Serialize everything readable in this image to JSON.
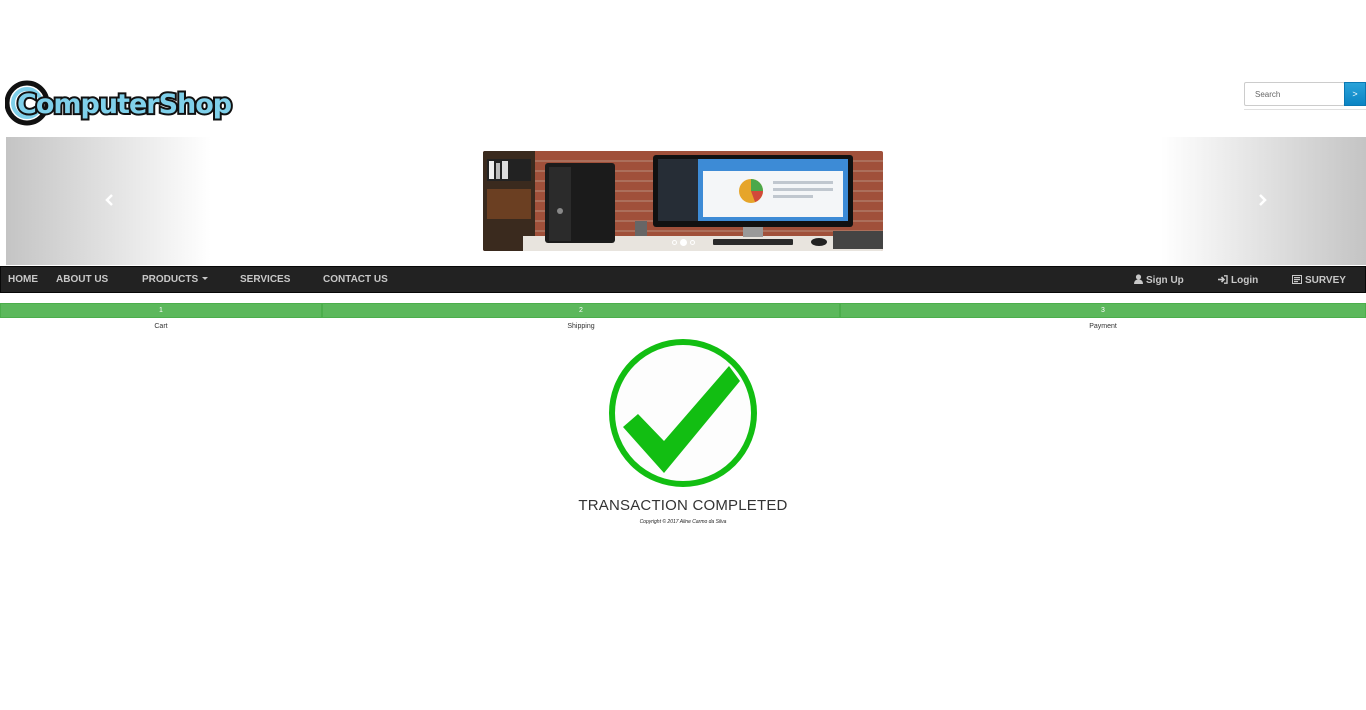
{
  "brand": {
    "logo_text": "ComputerShop"
  },
  "search": {
    "placeholder": "Search",
    "button_label": ">"
  },
  "carousel": {
    "slide_count": 3,
    "active_index": 1
  },
  "nav": {
    "left": [
      {
        "label": "HOME"
      },
      {
        "label": "ABOUT US"
      },
      {
        "label": "PRODUCTS"
      },
      {
        "label": "SERVICES"
      },
      {
        "label": "CONTACT US"
      }
    ],
    "right": [
      {
        "label": "Sign Up",
        "icon": "user-icon"
      },
      {
        "label": "Login",
        "icon": "login-icon"
      },
      {
        "label": "SURVEY",
        "icon": "survey-icon"
      }
    ]
  },
  "steps": [
    {
      "number": "1",
      "label": "Cart"
    },
    {
      "number": "2",
      "label": "Shipping"
    },
    {
      "number": "3",
      "label": "Payment"
    }
  ],
  "result": {
    "title": "TRANSACTION COMPLETED",
    "copyright": "Copyright © 2017 Aline Carmo da Silva"
  },
  "colors": {
    "navbar": "#222222",
    "progress": "#5cb85c",
    "check": "#12be12",
    "search_button": "#1a94d0"
  }
}
